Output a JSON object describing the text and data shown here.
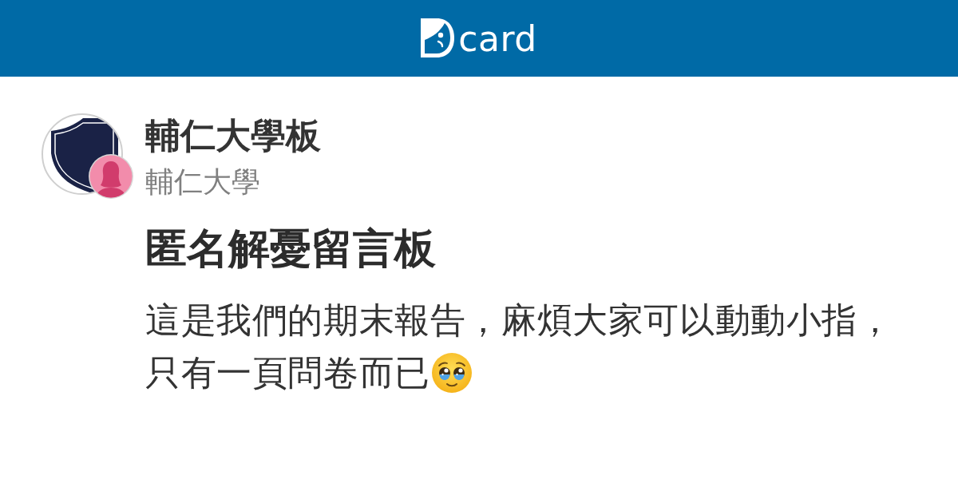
{
  "header": {
    "logo_text": "card"
  },
  "board": {
    "name": "輔仁大學板",
    "school": "輔仁大學"
  },
  "post": {
    "title": "匿名解憂留言板",
    "body_lines": [
      "這是我們的期末報告，麻煩大家可以動動小指，",
      "只有一頁問卷而已"
    ]
  }
}
